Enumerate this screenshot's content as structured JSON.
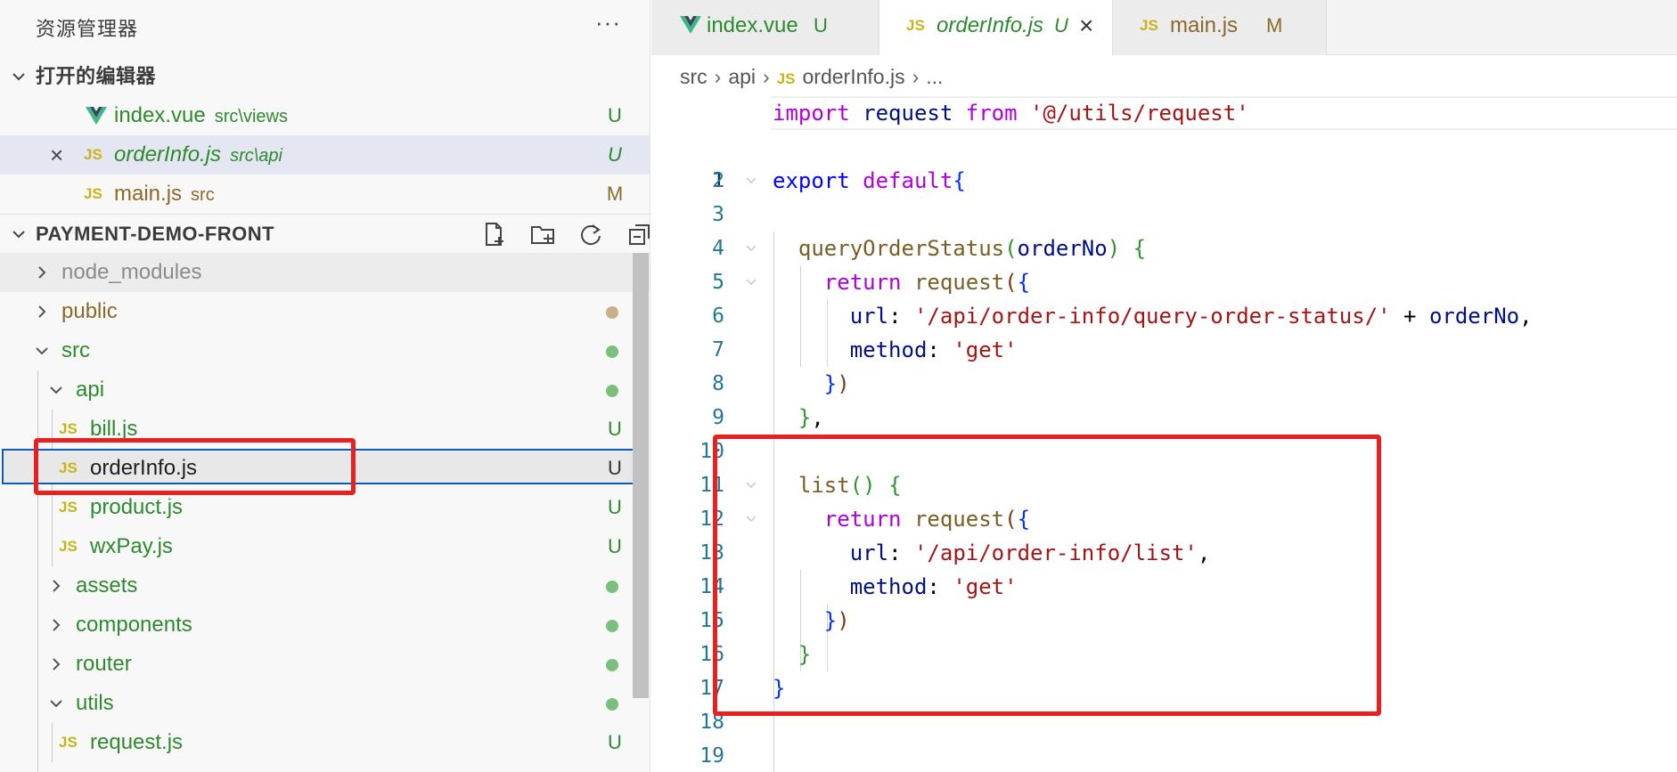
{
  "sidebar": {
    "title": "资源管理器",
    "more": "···",
    "open_editors": {
      "title": "打开的编辑器",
      "items": [
        {
          "name": "index.vue",
          "path": "src\\views",
          "status": "U",
          "icon": "vue-icon"
        },
        {
          "name": "orderInfo.js",
          "path": "src\\api",
          "status": "U",
          "icon": "js-icon",
          "close": "×"
        },
        {
          "name": "main.js",
          "path": "src",
          "status": "M",
          "icon": "js-icon"
        }
      ]
    },
    "project": {
      "title": "PAYMENT-DEMO-FRONT",
      "tree": [
        {
          "name": "node_modules"
        },
        {
          "name": "public"
        },
        {
          "name": "src"
        },
        {
          "name": "api"
        },
        {
          "name": "bill.js",
          "status": "U"
        },
        {
          "name": "orderInfo.js",
          "status": "U"
        },
        {
          "name": "product.js",
          "status": "U"
        },
        {
          "name": "wxPay.js",
          "status": "U"
        },
        {
          "name": "assets"
        },
        {
          "name": "components"
        },
        {
          "name": "router"
        },
        {
          "name": "utils"
        },
        {
          "name": "request.js",
          "status": "U"
        }
      ]
    },
    "js_badge": "JS"
  },
  "editor": {
    "tabs": [
      {
        "name": "index.vue",
        "status": "U"
      },
      {
        "name": "orderInfo.js",
        "status": "U",
        "close": "×"
      },
      {
        "name": "main.js",
        "status": "M"
      }
    ],
    "breadcrumb": [
      "src",
      "api",
      "orderInfo.js",
      "..."
    ],
    "line_numbers": [
      "1",
      "2",
      "3",
      "4",
      "5",
      "6",
      "7",
      "8",
      "9",
      "10",
      "11",
      "12",
      "13",
      "14",
      "15",
      "16",
      "17",
      "18",
      "19"
    ],
    "code": {
      "l1": {
        "import": "import",
        "request": "request",
        "from": "from",
        "path": "'@/utils/request'"
      },
      "l3": {
        "export": "export",
        "default": "default",
        "brace": "{"
      },
      "l5": {
        "fn": "queryOrderStatus",
        "open": "(",
        "param": "orderNo",
        "close": ")",
        "brace": "{"
      },
      "l6": {
        "return": "return",
        "request": "request",
        "open": "(",
        "brace": "{"
      },
      "l7": {
        "key": "url",
        "colon": ":",
        "str": "'/api/order-info/query-order-status/'",
        "plus": "+",
        "var": "orderNo",
        "comma": ","
      },
      "l8": {
        "key": "method",
        "colon": ":",
        "str": "'get'"
      },
      "l9": {
        "brace": "}",
        "close": ")"
      },
      "l10": {
        "brace": "}",
        "comma": ","
      },
      "l12": {
        "fn": "list",
        "parens": "()",
        "brace": "{"
      },
      "l13": {
        "return": "return",
        "request": "request",
        "open": "(",
        "brace": "{"
      },
      "l14": {
        "key": "url",
        "colon": ":",
        "str": "'/api/order-info/list'",
        "comma": ","
      },
      "l15": {
        "key": "method",
        "colon": ":",
        "str": "'get'"
      },
      "l16": {
        "brace": "}",
        "close": ")"
      },
      "l17": {
        "brace": "}"
      },
      "l18": {
        "brace": "}"
      }
    }
  },
  "colors": {
    "annotation_red": "#e8201f",
    "selection_border": "#0e5ab8",
    "untracked_green": "#2e8a2e",
    "modified_olive": "#8a6a2a"
  }
}
